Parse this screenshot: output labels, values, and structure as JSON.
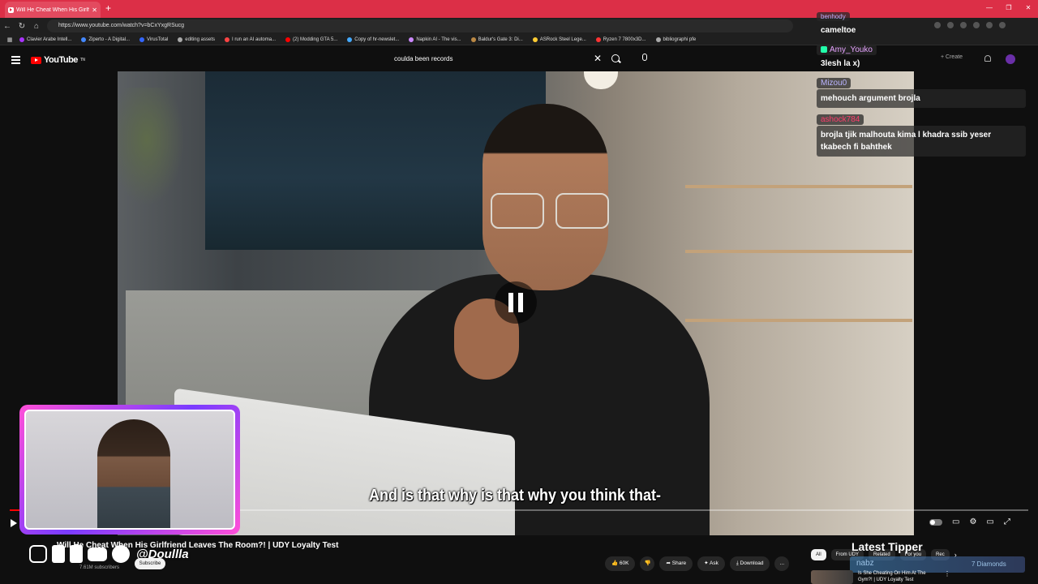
{
  "browser": {
    "tab_title": "Will He Cheat When His Girlfri",
    "url": "https://www.youtube.com/watch?v=bCxYxgRSucg",
    "bookmarks": [
      {
        "label": "Clavier Arabe Intell...",
        "color": "#a3f"
      },
      {
        "label": "Ziperto - A Digital...",
        "color": "#48f"
      },
      {
        "label": "VirusTotal",
        "color": "#36f"
      },
      {
        "label": "editing assets",
        "color": "#aaa"
      },
      {
        "label": "I run an AI automa...",
        "color": "#f44"
      },
      {
        "label": "(2) Modding GTA 5...",
        "color": "#f00"
      },
      {
        "label": "Copy of hr-newslet...",
        "color": "#4af"
      },
      {
        "label": "Napkin AI - The vis...",
        "color": "#c8f"
      },
      {
        "label": "Baldur's Gate 3: Di...",
        "color": "#b84"
      },
      {
        "label": "ASRock Steel Lege...",
        "color": "#fc3"
      },
      {
        "label": "Ryzen 7 7800x3D...",
        "color": "#f33"
      },
      {
        "label": "bibliographi pfe",
        "color": "#aaa"
      }
    ]
  },
  "youtube": {
    "logo_text": "YouTube",
    "logo_sup": "TN",
    "search_value": "coulda been records",
    "create_label": "Create"
  },
  "video": {
    "caption": "And is that why is that why you think that-",
    "progress_fraction": 0.01
  },
  "below": {
    "title": "Will He Cheat When His Girlfriend Leaves The Room?! | UDY Loyalty Test",
    "handle": "@Doullla",
    "subscribers": "7.61M subscribers",
    "subscribe_label": "Subscribe",
    "likes": "60K",
    "share": "Share",
    "ask": "Ask",
    "download": "Download",
    "more": "...",
    "filters": [
      "All",
      "From UDY",
      "Related",
      "For you",
      "Rec"
    ],
    "latest_tipper_label": "Latest Tipper",
    "tipper_name": "nabz",
    "tipper_amount": "7 Diamonds",
    "rec_title": "Is She Cheating On Him At The Gym?! | UDY Loyalty Test"
  },
  "chat": [
    {
      "user": "cameltoe",
      "user_color": "#ffffff",
      "msg": "",
      "plain": true,
      "top_user": "benhody"
    },
    {
      "user": "Amy_Youko",
      "user_color": "#e6a3ff",
      "msg": "3lesh la x)",
      "plain": true,
      "badge": true
    },
    {
      "user": "Mizou0",
      "user_color": "#b9b3ff",
      "msg": "mehouch argument brojla"
    },
    {
      "user": "ashock784",
      "user_color": "#ff3b6b",
      "msg": "brojla tjik malhouta kima l khadra ssib yeser tkabech fi bahthek"
    }
  ]
}
